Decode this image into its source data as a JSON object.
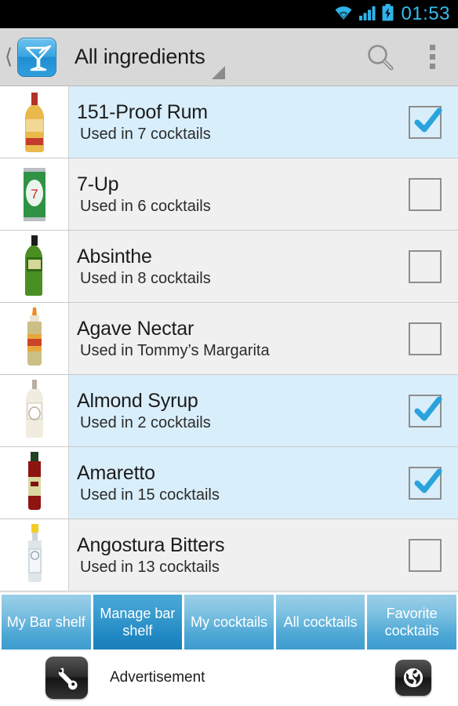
{
  "statusbar": {
    "time": "01:53",
    "icons": [
      "wifi-icon",
      "signal-icon",
      "battery-charging-icon"
    ],
    "accent_color": "#36bdf0"
  },
  "actionbar": {
    "app_icon": "martini-glass-icon",
    "back_icon": "back-chevron-icon",
    "title": "All ingredients",
    "spinner_indicator": "dropdown-triangle-icon",
    "search_icon": "search-icon",
    "overflow_icon": "overflow-menu-icon",
    "background_color": "#d8d8d8"
  },
  "list": {
    "checked_row_color": "#d9eefb",
    "unchecked_row_color": "#f0f0f0",
    "items": [
      {
        "name": "151-Proof Rum",
        "subtitle": "Used in 7 cocktails",
        "checked": true,
        "thumb": "rum-bottle-thumbnail"
      },
      {
        "name": "7-Up",
        "subtitle": "Used in 6 cocktails",
        "checked": false,
        "thumb": "soda-can-thumbnail"
      },
      {
        "name": "Absinthe",
        "subtitle": "Used in 8 cocktails",
        "checked": false,
        "thumb": "absinthe-bottle-thumbnail"
      },
      {
        "name": "Agave Nectar",
        "subtitle": "Used in Tommy’s Margarita",
        "checked": false,
        "thumb": "agave-bottle-thumbnail"
      },
      {
        "name": "Almond Syrup",
        "subtitle": "Used in 2 cocktails",
        "checked": true,
        "thumb": "syrup-bottle-thumbnail"
      },
      {
        "name": "Amaretto",
        "subtitle": "Used in 15 cocktails",
        "checked": true,
        "thumb": "amaretto-bottle-thumbnail"
      },
      {
        "name": "Angostura Bitters",
        "subtitle": "Used in 13 cocktails",
        "checked": false,
        "thumb": "bitters-bottle-thumbnail"
      }
    ]
  },
  "tabs": {
    "active_index": 1,
    "items": [
      {
        "label": "My Bar shelf"
      },
      {
        "label": "Manage bar shelf"
      },
      {
        "label": "My cocktails"
      },
      {
        "label": "All cocktails"
      },
      {
        "label": "Favorite cocktails"
      }
    ]
  },
  "ad": {
    "left_icon": "wrench-icon",
    "label": "Advertisement",
    "right_icon": "globe-icon"
  }
}
